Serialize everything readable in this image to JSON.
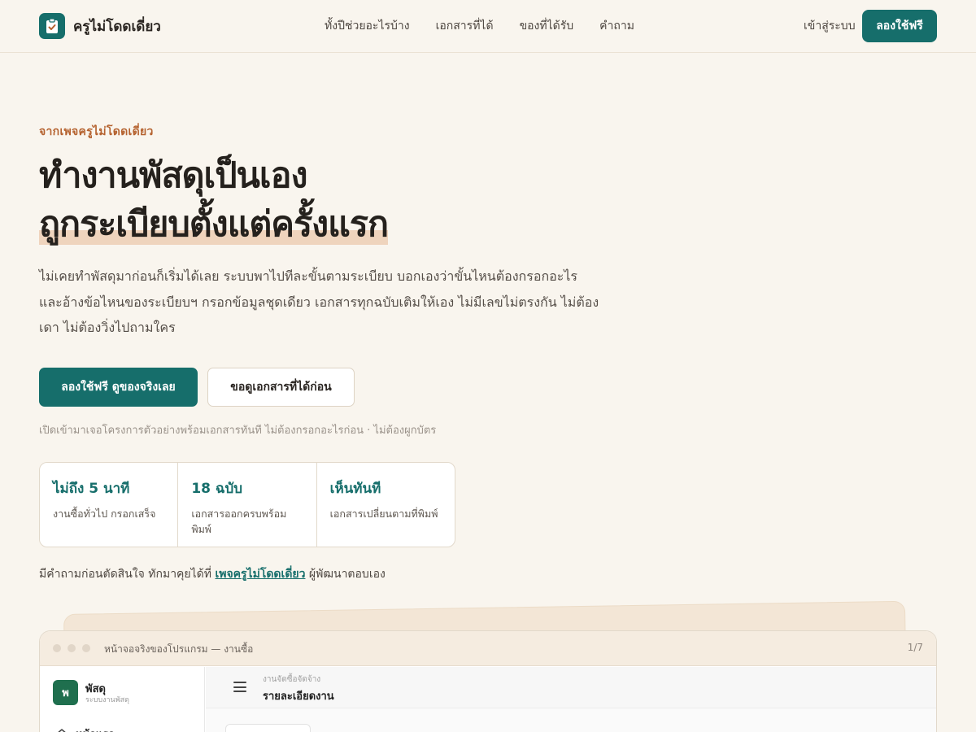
{
  "brand": {
    "name": "ครูไม่โดดเดี่ยว",
    "logo_icon": "checklist-icon"
  },
  "nav": {
    "links": [
      "ทั้งปีช่วยอะไรบ้าง",
      "เอกสารที่ได้",
      "ของที่ได้รับ",
      "คำถาม"
    ],
    "login": "เข้าสู่ระบบ",
    "cta": "ลองใช้ฟรี"
  },
  "hero": {
    "eyebrow": "จากเพจครูไม่โดดเดี่ยว",
    "headline_1": "ทำงานพัสดุเป็นเอง",
    "headline_2": "ถูกระเบียบตั้งแต่ครั้งแรก",
    "lede": "ไม่เคยทำพัสดุมาก่อนก็เริ่มได้เลย ระบบพาไปทีละขั้นตามระเบียบ บอกเองว่าขั้นไหนต้องกรอกอะไร และอ้างข้อไหนของระเบียบฯ กรอกข้อมูลชุดเดียว เอกสารทุกฉบับเติมให้เอง ไม่มีเลขไม่ตรงกัน ไม่ต้องเดา ไม่ต้องวิ่งไปถามใคร",
    "primary_cta": "ลองใช้ฟรี ดูของจริงเลย",
    "secondary_cta": "ขอดูเอกสารที่ได้ก่อน",
    "footnote": "เปิดเข้ามาเจอโครงการตัวอย่างพร้อมเอกสารทันที ไม่ต้องกรอกอะไรก่อน · ไม่ต้องผูกบัตร"
  },
  "stats": [
    {
      "value": "ไม่ถึง 5 นาที",
      "desc": "งานซื้อทั่วไป กรอกเสร็จ"
    },
    {
      "value": "18 ฉบับ",
      "desc": "เอกสารออกครบพร้อมพิมพ์"
    },
    {
      "value": "เห็นทันที",
      "desc": "เอกสารเปลี่ยนตามที่พิมพ์"
    }
  ],
  "contact": {
    "prefix": "มีคำถามก่อนตัดสินใจ ทักมาคุยได้ที่",
    "link": "เพจครูไม่โดดเดี่ยว",
    "suffix": "ผู้พัฒนาตอบเอง"
  },
  "preview": {
    "title": "หน้าจอจริงของโปรแกรม — งานซื้อ",
    "page": "1/7",
    "app": {
      "logo_letter": "พ",
      "name": "พัสดุ",
      "subtitle": "ระบบงานพัสดุ",
      "nav_item": "หน้าแรก",
      "breadcrumb": "งานจัดซื้อจัดจ้าง",
      "page_title": "รายละเอียดงาน"
    }
  },
  "colors": {
    "accent": "#166e6b",
    "eyebrow": "#b5622f",
    "highlight": "#efd4bd",
    "background": "#f9f5ee"
  }
}
